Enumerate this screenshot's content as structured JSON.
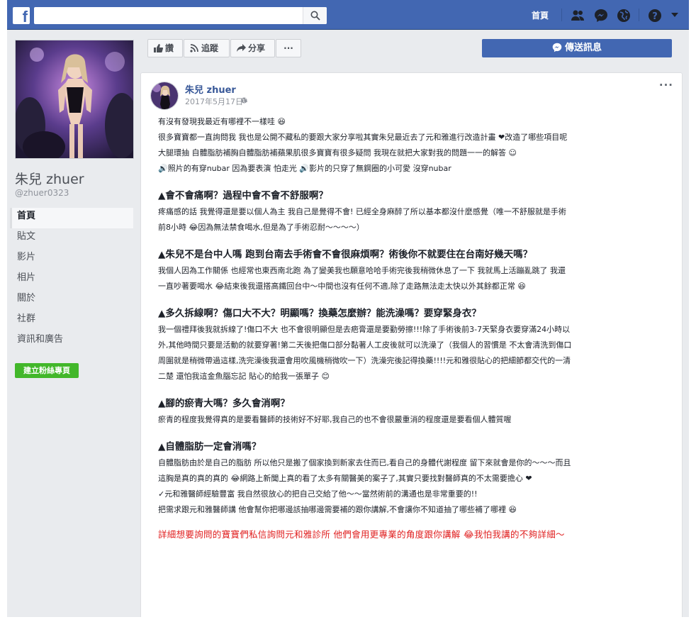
{
  "topbar": {
    "logo": "f",
    "search_placeholder": "",
    "home_label": "首頁",
    "icons": [
      "friends-icon",
      "messenger-icon",
      "globe-icon",
      "help-icon",
      "caret-down-icon"
    ]
  },
  "profile": {
    "name": "朱兒 zhuer",
    "handle": "@zhuer0323",
    "nav": [
      "首頁",
      "貼文",
      "影片",
      "相片",
      "關於",
      "社群",
      "資訊和廣告"
    ],
    "create_button": "建立粉絲專頁"
  },
  "actions": {
    "like": "讚",
    "follow": "追蹤",
    "share": "分享",
    "more": "···",
    "message": "傳送訊息"
  },
  "post": {
    "author": "朱兒 zhuer",
    "date": "2017年5月17日 ·",
    "menu": "···",
    "lines": {
      "l1": "有沒有發現我最近有哪裡不一樣哇 😆",
      "l2": "很多寶寶都一直詢問我 我也是公開不藏私的要跟大家分享啦其實朱兒最近去了元和雅進行改造計畫 ❤改造了哪些項目呢",
      "l3": "大腿環抽 自體脂肪補胸自體脂肪補蘋果肌很多寶寶有很多疑問 我現在就把大家對我的問題一一的解答 ☺",
      "l4": "🔊照片的有穿nubar 因為要表演 怕走光 🔊影片的只穿了無鋼圈的小可愛 沒穿nubar",
      "h1": "▲會不會痛啊？過程中會不會不舒服啊？",
      "l5": "疼痛感的話 我覺得還是要以個人為主 我自己是覺得不會! 已經全身麻醉了所以基本都沒什麼感覺（唯一不舒服就是手術",
      "l6": "前8小時 😂因為無法禁食喝水,但是為了手術忍耐～～～～）",
      "h2": "▲朱兒不是台中人嗎 跑到台南去手術會不會很麻煩啊？術後你不就要住在台南好幾天嗎？",
      "l7": "我個人因為工作關係 也經常也東西南北跑 為了變美我也願意哈哈手術完後我稍微休息了一下 我就馬上活蹦亂跳了 我還",
      "l8": "一直吵著要喝水 😂結束後我還搭高鐵回台中～中間也沒有任何不適,除了走路無法走太快以外其餘都正常 😆",
      "h3": "▲多久拆線啊？傷口大不大？明顯嗎？換藥怎麼辦？能洗澡嗎？要穿緊身衣？",
      "l9": "我一個禮拜後我就拆線了!傷口不大 也不會很明顯但是去疤膏還是要勤勞擦!!!除了手術後前3-7天緊身衣要穿滿24小時以",
      "l10": "外,其他時間只要是活動的就要穿著!第二天後把傷口部分黏著人工皮後就可以洗澡了（我個人的習慣是 不太會清洗到傷口",
      "l11": "周圍就是稍微帶過這樣,洗完澡後我還會用吹風機稍微吹一下）洗澡完後記得換藥!!!!元和雅很貼心的把細節都交代的一清",
      "l12": "二楚 還怕我這金魚腦忘記 貼心的給我一張單子 😊",
      "h4": "▲腳的瘀青大嗎？多久會消啊？",
      "l13": "瘀青的程度我覺得真的是要看醫師的技術好不好耶,我自己的也不會很嚴重消的程度還是要看個人體質喔",
      "h5": "▲自體脂肪一定會消嗎？",
      "l14": "自體脂肪由於是自己的脂肪 所以他只是搬了個家換到新家去住而已,看自己的身體代謝程度 留下來就會是你的～～～而且",
      "l15": "這胸是真的真的真的 😂網路上新聞上真的看了太多有關醫美的案子了,其實只要找對醫師真的不太需要擔心 ❤",
      "l16": "✓元和雅醫師經驗豐富 我自然很放心的把自己交給了他～～當然術前的溝通也是非常重要的!!",
      "l17": "把需求跟元和雅醫師講 他會幫你把哪邊該抽哪邊需要補的跟你講解,不會讓你不知道抽了哪些補了哪裡 😆",
      "l18": "詳細想要詢問的寶寶們私信詢問元和雅診所 他們會用更專業的角度跟你講解 😂我怕我講的不夠詳細～"
    }
  },
  "colors": {
    "brand": "#4267b2",
    "link": "#385898",
    "accent_green": "#42b72a",
    "highlight_red": "#e02020",
    "background": "#e9ebee"
  }
}
